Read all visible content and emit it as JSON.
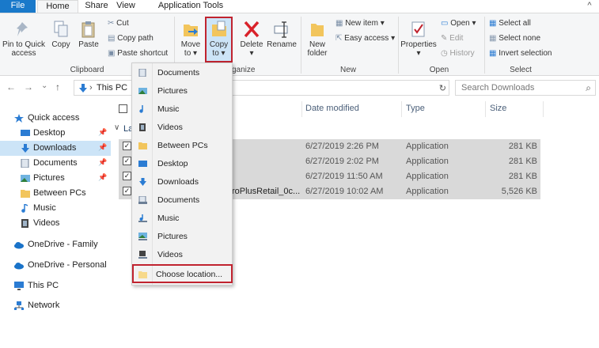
{
  "tabs": {
    "file": "File",
    "home": "Home",
    "share": "Share",
    "view": "View",
    "app_tools": "Application Tools",
    "expand": "^"
  },
  "ribbon": {
    "clipboard": {
      "pin_line1": "Pin to Quick",
      "pin_line2": "access",
      "copy": "Copy",
      "paste": "Paste",
      "cut": "Cut",
      "copy_path": "Copy path",
      "paste_shortcut": "Paste shortcut",
      "group_label": "Clipboard"
    },
    "organize": {
      "move_line1": "Move",
      "move_line2": "to ▾",
      "copy_line1": "Copy",
      "copy_line2": "to ▾",
      "delete": "Delete",
      "delete_arrow": "▾",
      "rename": "Rename",
      "group_label_partial": "ganize"
    },
    "new": {
      "new_folder_line1": "New",
      "new_folder_line2": "folder",
      "new_item": "New item ▾",
      "easy_access": "Easy access ▾",
      "group_label": "New"
    },
    "open": {
      "properties": "Properties",
      "properties_arrow": "▾",
      "open": "Open ▾",
      "edit": "Edit",
      "history": "History",
      "group_label": "Open"
    },
    "select": {
      "select_all": "Select all",
      "select_none": "Select none",
      "invert_selection": "Invert selection",
      "group_label": "Select"
    }
  },
  "nav": {
    "back": "←",
    "forward": "→",
    "recent": "⌄",
    "up": "↑",
    "path_sep": "›",
    "path": "This PC",
    "refresh": "↻",
    "search_placeholder": "Search Downloads",
    "search_icon": "⌕"
  },
  "navpane": {
    "quick_access": "Quick access",
    "desktop": "Desktop",
    "downloads": "Downloads",
    "documents": "Documents",
    "pictures": "Pictures",
    "between_pcs": "Between PCs",
    "music": "Music",
    "videos": "Videos",
    "onedrive_family": "OneDrive - Family",
    "onedrive_personal": "OneDrive - Personal",
    "this_pc": "This PC",
    "network": "Network",
    "pin": "📌"
  },
  "files": {
    "headers": {
      "date": "Date modified",
      "type": "Type",
      "size": "Size"
    },
    "group_label_partial": "La",
    "group_chevron": "∨",
    "rows": [
      {
        "name": "",
        "date": "6/27/2019 2:26 PM",
        "type": "Application",
        "size": "281 KB"
      },
      {
        "name": "",
        "date": "6/27/2019 2:02 PM",
        "type": "Application",
        "size": "281 KB"
      },
      {
        "name": "",
        "date": "6/27/2019 11:50 AM",
        "type": "Application",
        "size": "281 KB"
      },
      {
        "name": "roPlusRetail_0c...",
        "date": "6/27/2019 10:02 AM",
        "type": "Application",
        "size": "5,526 KB"
      }
    ],
    "check": "✓"
  },
  "menu": {
    "items": [
      {
        "label": "Documents",
        "icon": "documents-icon"
      },
      {
        "label": "Pictures",
        "icon": "pictures-icon"
      },
      {
        "label": "Music",
        "icon": "music-icon"
      },
      {
        "label": "Videos",
        "icon": "videos-icon"
      },
      {
        "label": "Between PCs",
        "icon": "folder-icon"
      },
      {
        "label": "Desktop",
        "icon": "desktop-icon"
      },
      {
        "label": "Downloads",
        "icon": "downloads-icon"
      },
      {
        "label": "Documents",
        "icon": "documents-icon"
      },
      {
        "label": "Music",
        "icon": "music-icon"
      },
      {
        "label": "Pictures",
        "icon": "pictures-icon"
      },
      {
        "label": "Videos",
        "icon": "videos-icon"
      },
      {
        "label": "Choose location...",
        "icon": "folder-icon"
      }
    ]
  },
  "colors": {
    "accent": "#1979ca",
    "highlight_red": "#c0232f",
    "selection": "#cce4f7"
  }
}
